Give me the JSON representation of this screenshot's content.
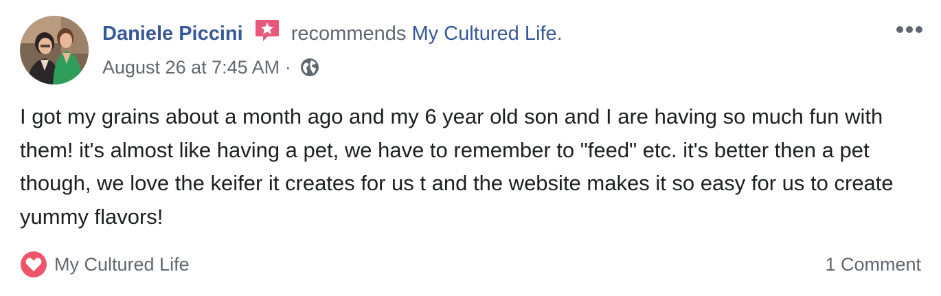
{
  "post": {
    "author": "Daniele Piccini",
    "action_text": "recommends",
    "page_name": "My Cultured Life",
    "period": ".",
    "timestamp": "August 26 at 7:45 AM",
    "separator": "·",
    "privacy_icon": "globe-icon",
    "recommend_icon": "recommendation-star-icon",
    "more_icon": "more-options-icon",
    "body": "I got my grains about a month ago and my 6 year old son and I are having so much fun with them! it's almost like having a pet, we have to remember to \"feed\" etc. it's better then a pet though, we love the keifer it creates for us t and the website makes it so easy for us to create yummy flavors!"
  },
  "footer": {
    "reaction_icon": "heart-icon",
    "reaction_label": "My Cultured Life",
    "comments_label": "1 Comment"
  },
  "colors": {
    "link": "#365899",
    "meta": "#606770",
    "text": "#1c1e21",
    "recommend_pink": "#e9587b",
    "heart_red": "#f0546b"
  }
}
